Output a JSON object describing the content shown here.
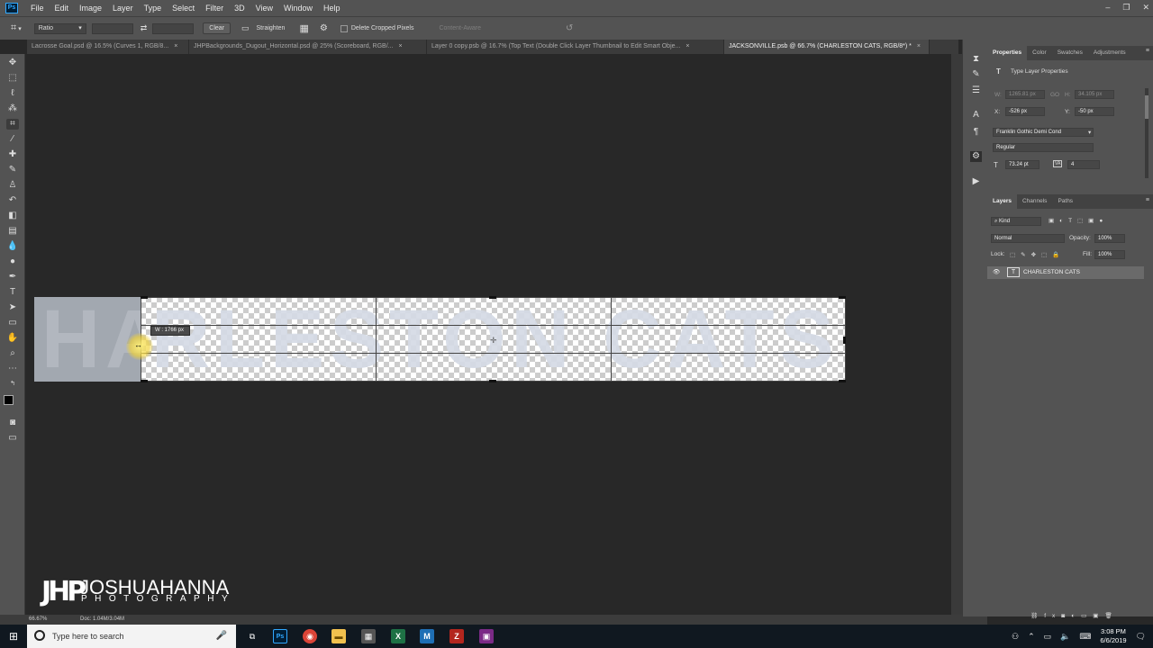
{
  "menu": {
    "items": [
      "File",
      "Edit",
      "Image",
      "Layer",
      "Type",
      "Select",
      "Filter",
      "3D",
      "View",
      "Window",
      "Help"
    ],
    "window_controls": [
      "–",
      "❐",
      "✕"
    ]
  },
  "options_bar": {
    "ratio": "Ratio",
    "clear": "Clear",
    "straighten": "Straighten",
    "delete_cropped": "Delete Cropped Pixels",
    "content_aware": "Content-Aware"
  },
  "tabs": [
    {
      "label": "Lacrosse Goal.psd @ 16.5% (Curves 1, RGB/8..."
    },
    {
      "label": "JHPBackgrounds_Dugout_Horizontal.psd @ 25% (Scoreboard, RGB/..."
    },
    {
      "label": "Layer 0 copy.psb @ 16.7% (Top Text (Double Click Layer Thumbnail to Edit Smart Obje..."
    },
    {
      "label": "JACKSONVILLE.psb @ 66.7% (CHARLESTON CATS, RGB/8*) *"
    }
  ],
  "canvas": {
    "outside_text": "HA",
    "inside_text": "RLESTON CATS",
    "width_tip": "W :  1766 px"
  },
  "status": {
    "zoom": "66.67%",
    "doc": "Doc: 1.04M/3.04M"
  },
  "brand": {
    "mark": "JHP",
    "name": "JOSHUAHANNA",
    "sub": "PHOTOGRAPHY"
  },
  "properties": {
    "tabs": [
      "Properties",
      "Color",
      "Swatches",
      "Adjustments"
    ],
    "title": "Type Layer Properties",
    "w_label": "W:",
    "w_value": "1265.81 px",
    "h_label": "H:",
    "h_value": "34.105 px",
    "link": "GO",
    "x_label": "X:",
    "x_value": "-526 px",
    "y_label": "Y:",
    "y_value": "-50 px",
    "font": "Franklin Gothic Demi Cond",
    "style": "Regular",
    "size": "73.24 pt",
    "tracking": "4"
  },
  "layers": {
    "tabs": [
      "Layers",
      "Channels",
      "Paths"
    ],
    "filter": "Kind",
    "blend": "Normal",
    "opacity_label": "Opacity:",
    "opacity": "100%",
    "lock_label": "Lock:",
    "fill_label": "Fill:",
    "fill": "100%",
    "layer_name": "CHARLESTON CATS"
  },
  "taskbar": {
    "search_placeholder": "Type here to search",
    "time": "3:08 PM",
    "date": "6/6/2019"
  }
}
